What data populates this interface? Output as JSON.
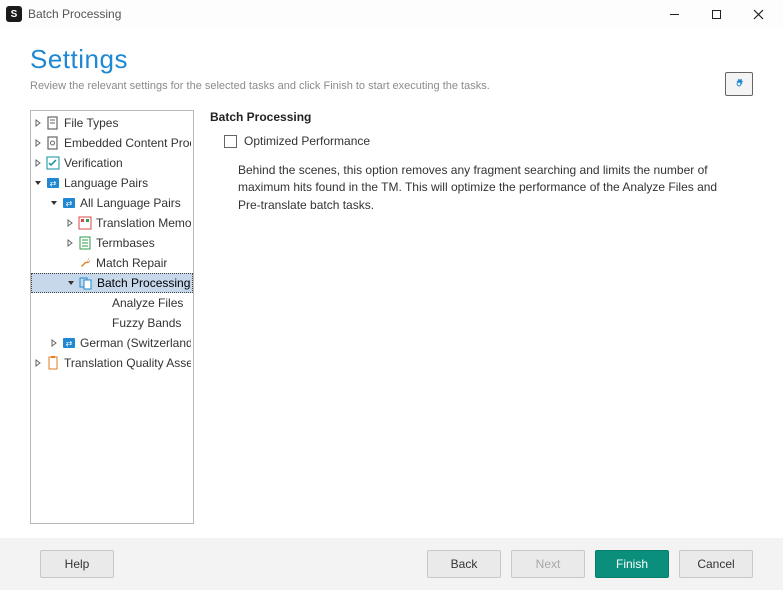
{
  "titlebar": {
    "title": "Batch Processing"
  },
  "header": {
    "title": "Settings",
    "subtitle": "Review the relevant settings for the selected tasks and click Finish to start executing the tasks."
  },
  "tree": {
    "file_types": "File Types",
    "embedded": "Embedded Content Processors",
    "verification": "Verification",
    "language_pairs": "Language Pairs",
    "all_lang_pairs": "All Language Pairs",
    "tm": "Translation Memory",
    "termbases": "Termbases",
    "match_repair": "Match Repair",
    "batch_processing": "Batch Processing",
    "analyze_files": "Analyze Files",
    "fuzzy_bands": "Fuzzy Bands",
    "german_ch": "German (Switzerland)",
    "tqa": "Translation Quality Assessment"
  },
  "content": {
    "heading": "Batch Processing",
    "checkbox_label": "Optimized Performance",
    "description": "Behind the scenes, this option removes any fragment searching and limits the number of maximum hits found in the TM. This will optimize the performance of the Analyze Files and Pre-translate batch tasks."
  },
  "footer": {
    "help": "Help",
    "back": "Back",
    "next": "Next",
    "finish": "Finish",
    "cancel": "Cancel"
  }
}
